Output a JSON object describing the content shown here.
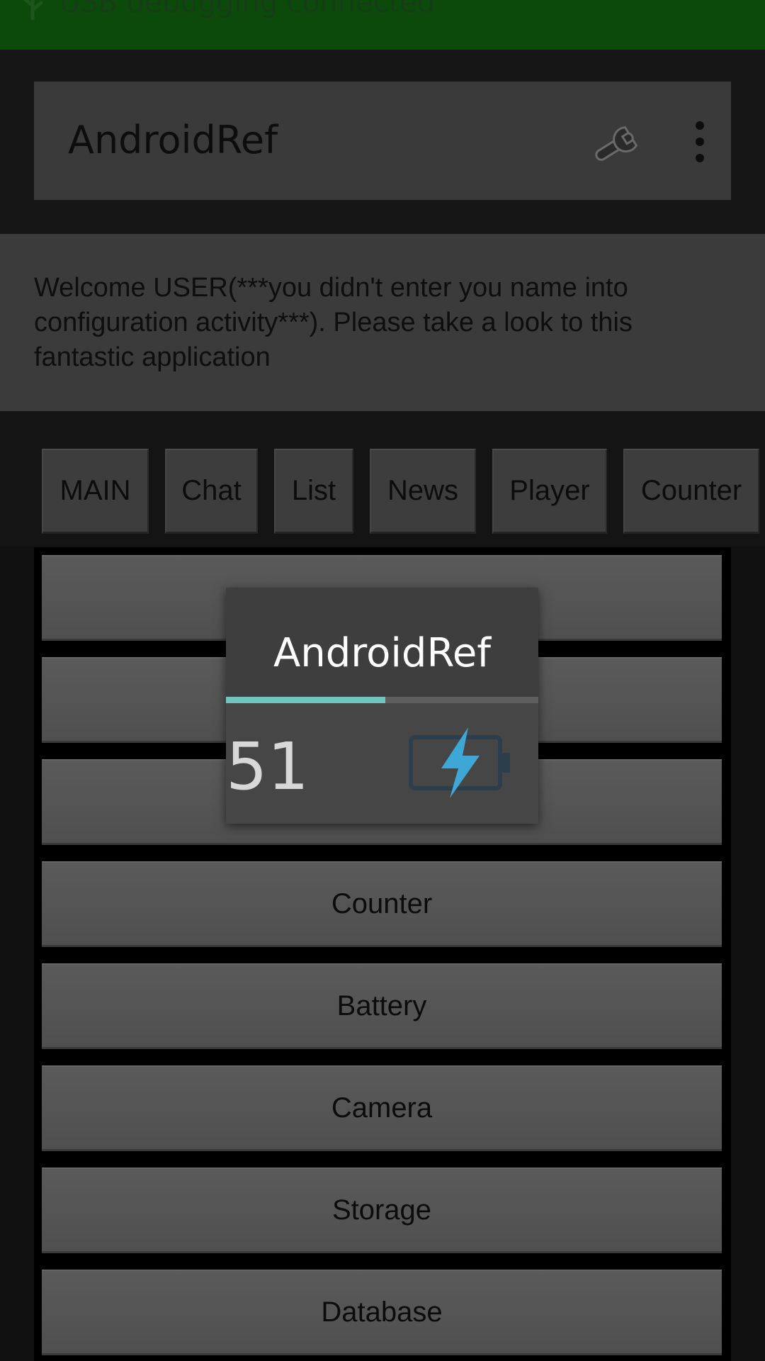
{
  "status_bar": {
    "text": "USB debugging connected",
    "icon": "usb-icon",
    "bg_color": "#0c4a0c"
  },
  "action_bar": {
    "title": "AndroidRef",
    "settings_icon": "wrench-icon",
    "menu_icon": "overflow-menu-icon"
  },
  "welcome": {
    "text": "Welcome USER(***you didn't enter you name into configuration activity***). Please take a look to this fantastic application"
  },
  "tabs": [
    {
      "label": "MAIN"
    },
    {
      "label": "Chat"
    },
    {
      "label": "List"
    },
    {
      "label": "News"
    },
    {
      "label": "Player"
    },
    {
      "label": "Counter"
    }
  ],
  "menu_buttons": [
    {
      "label": ""
    },
    {
      "label": ""
    },
    {
      "label": ""
    },
    {
      "label": "Counter"
    },
    {
      "label": "Battery"
    },
    {
      "label": "Camera"
    },
    {
      "label": "Storage"
    },
    {
      "label": "Database"
    }
  ],
  "popup": {
    "title": "AndroidRef",
    "battery_level": "51",
    "progress_fraction": 0.51,
    "accent_color": "#6dc5bd",
    "icon": "battery-charging-icon",
    "icon_color": "#3fa7d6"
  }
}
